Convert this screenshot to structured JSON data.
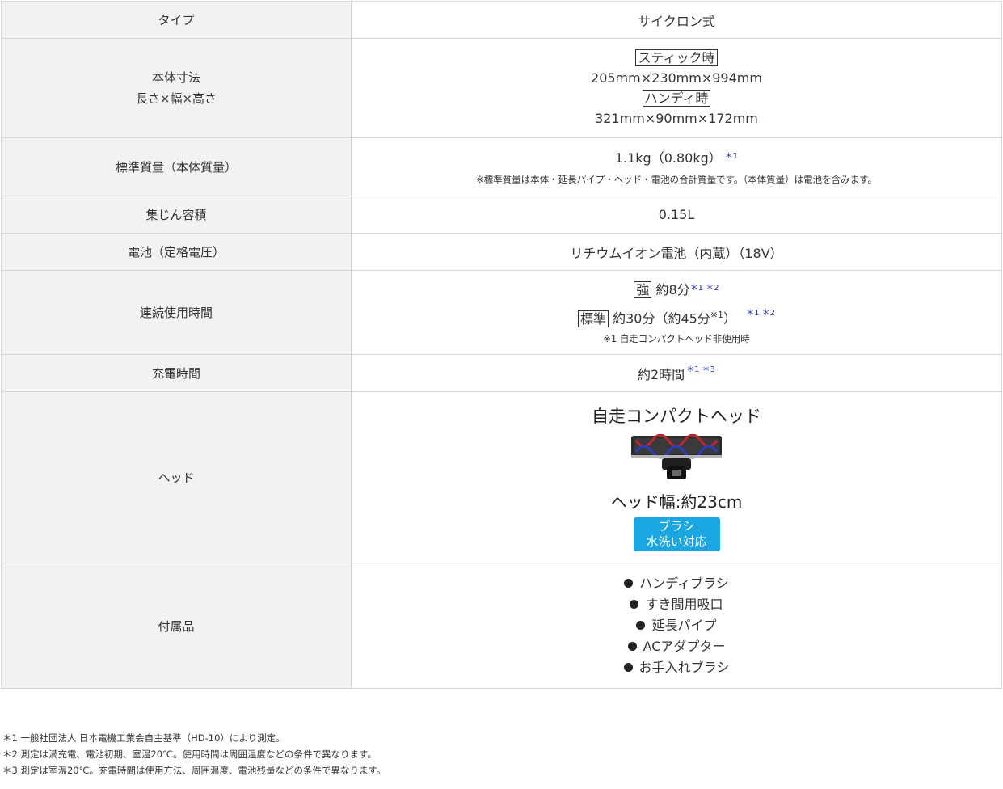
{
  "rows": {
    "type": {
      "label": "タイプ",
      "value": "サイクロン式"
    },
    "dimensions": {
      "label_line1": "本体寸法",
      "label_line2": "長さ×幅×高さ",
      "stick_tag": "スティック時",
      "stick_value": "205mm×230mm×994mm",
      "handy_tag": "ハンディ時",
      "handy_value": "321mm×90mm×172mm"
    },
    "mass": {
      "label": "標準質量（本体質量）",
      "value": "1.1kg（0.80kg）",
      "mark": "＊1",
      "note": "※標準質量は本体・延長パイプ・ヘッド・電池の合計質量です。（本体質量）は電池を含みます。"
    },
    "dust": {
      "label": "集じん容積",
      "value": "0.15L"
    },
    "battery": {
      "label": "電池（定格電圧）",
      "value": "リチウムイオン電池（内蔵）（18V）"
    },
    "runtime": {
      "label": "連続使用時間",
      "strong_tag": "強",
      "strong_value": "約8分",
      "strong_mark": "＊1 ＊2",
      "std_tag": "標準",
      "std_value": "約30分（約45分",
      "std_sup": "※1",
      "std_close": "）",
      "std_mark": "＊1 ＊2",
      "note": "※1 自走コンパクトヘッド非使用時"
    },
    "charge": {
      "label": "充電時間",
      "value": "約2時間",
      "mark": "＊1 ＊3"
    },
    "head": {
      "label": "ヘッド",
      "title": "自走コンパクトヘッド",
      "width": "ヘッド幅:約23cm",
      "badge_line1": "ブラシ",
      "badge_line2": "水洗い対応"
    },
    "accessories": {
      "label": "付属品",
      "items": [
        "ハンディブラシ",
        "すき間用吸口",
        "延長パイプ",
        "ACアダプター",
        "お手入れブラシ"
      ]
    }
  },
  "footnotes": [
    "＊1 一般社団法人 日本電機工業会自主基準（HD-10）により測定。",
    "＊2 測定は満充電、電池初期、室温20℃。使用時間は周囲温度などの条件で異なります。",
    "＊3 測定は室温20℃。充電時間は使用方法、周囲温度、電池残量などの条件で異なります。"
  ],
  "colors": {
    "label_bg": "#f2f2f2",
    "mark": "#2530b4",
    "badge": "#1aa6e0"
  }
}
